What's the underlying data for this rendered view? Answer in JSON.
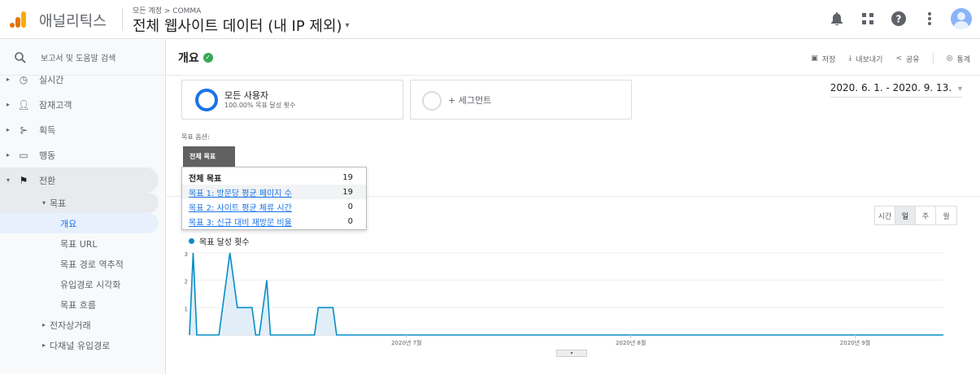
{
  "header": {
    "app_name": "애널리틱스",
    "breadcrumb": "모든 계정 > COMMA",
    "property_title": "전체 웹사이트 데이터 (내 IP 제외)"
  },
  "sidebar": {
    "search_placeholder": "보고서 및 도움말 검색",
    "items": [
      {
        "label": "실시간"
      },
      {
        "label": "잠재고객"
      },
      {
        "label": "획득"
      },
      {
        "label": "행동"
      },
      {
        "label": "전환"
      }
    ],
    "goals_label": "목표",
    "goal_sub": [
      "개요",
      "목표 URL",
      "목표 경로 역추적",
      "유입경로 시각화",
      "목표 흐름"
    ],
    "ecommerce": "전자상거래",
    "multichannel": "다채널 유입경로"
  },
  "page": {
    "title": "개요",
    "actions": {
      "save": "저장",
      "export": "내보내기",
      "share": "공유",
      "insights": "통계"
    }
  },
  "segments": {
    "seg1_name": "모든 사용자",
    "seg1_sub": "100.00% 목표 달성 횟수",
    "add_segment": "+ 세그먼트"
  },
  "date_range": "2020. 6. 1. - 2020. 9. 13.",
  "goal_option": {
    "label": "목표 옵션:",
    "selected": "전체 목표",
    "menu": [
      {
        "label": "전체 목표",
        "value": "19"
      },
      {
        "label": "목표 1: 방문당 평균 페이지 수",
        "value": "19"
      },
      {
        "label": "목표 2: 사이트 평균 체류 시간",
        "value": "0"
      },
      {
        "label": "목표 3: 신규 대비 재방문 비율",
        "value": "0"
      }
    ]
  },
  "period_buttons": [
    "시간",
    "일",
    "주",
    "월"
  ],
  "colors": {
    "accent": "#1a73e8",
    "series": "#058dc7",
    "fill": "#e1eef7",
    "ok": "#34a853"
  },
  "chart_data": {
    "type": "area",
    "series": [
      {
        "name": "목표 달성 횟수",
        "values": [
          0,
          3,
          0,
          0,
          0,
          0,
          0,
          0,
          0,
          1,
          2,
          3,
          2,
          1,
          1,
          1,
          1,
          1,
          0,
          0,
          1,
          2,
          0,
          0,
          0,
          0,
          0,
          0,
          0,
          0,
          0,
          0,
          0,
          0,
          0,
          1,
          1,
          1,
          1,
          1,
          0,
          0,
          0,
          0,
          0,
          0,
          0,
          0,
          0,
          0,
          0,
          0,
          0,
          0,
          0,
          0,
          0,
          0,
          0,
          0,
          0,
          0,
          0,
          0,
          0,
          0,
          0,
          0,
          0,
          0,
          0,
          0,
          0,
          0,
          0,
          0,
          0,
          0,
          0,
          0,
          0,
          0,
          0,
          0,
          0,
          0,
          0,
          0,
          0,
          0,
          0,
          0,
          0,
          0,
          0,
          0,
          0,
          0,
          0,
          0,
          0,
          0,
          0,
          0,
          0,
          0,
          0,
          0,
          0,
          0,
          0,
          0,
          0,
          0,
          0,
          0,
          0,
          0,
          0,
          0,
          0,
          0,
          0,
          0,
          0,
          0,
          0,
          0,
          0,
          0,
          0,
          0,
          0,
          0,
          0,
          0,
          0,
          0,
          0,
          0,
          0,
          0,
          0,
          0,
          0,
          0,
          0,
          0,
          0,
          0,
          0,
          0,
          0,
          0,
          0,
          0,
          0,
          0,
          0,
          0,
          0,
          0,
          0,
          0,
          0,
          0,
          0,
          0,
          0,
          0,
          0,
          0,
          0,
          0,
          0,
          0,
          0,
          0,
          0,
          0,
          0,
          0,
          0,
          0,
          0,
          0,
          0,
          0,
          0,
          0,
          0,
          0,
          0,
          0,
          0,
          0,
          0,
          0,
          0,
          0,
          0,
          0,
          0,
          0,
          0,
          0
        ]
      }
    ],
    "x_tick_labels": [
      "2020년 7월",
      "2020년 8월",
      "2020년 9월"
    ],
    "y_tick_labels": [
      "3",
      "2",
      "1"
    ],
    "ylim": [
      0,
      3
    ]
  }
}
